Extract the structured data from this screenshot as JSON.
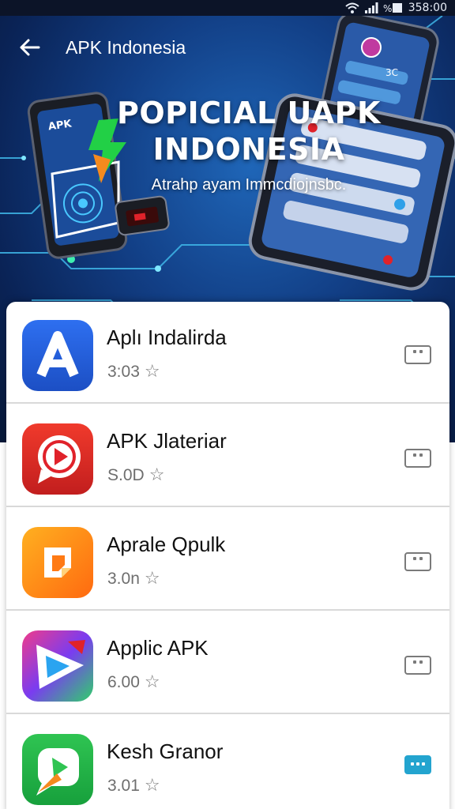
{
  "status_bar": {
    "time": "358:00"
  },
  "app_bar": {
    "title": "APK Indonesia"
  },
  "banner": {
    "title_line1": "POPICIAL UAPK",
    "title_line2": "INDONESIA",
    "subtitle": "Atrahp ayam Immcdiojnsbc.",
    "phone_label": "APK",
    "phone_value": "3C"
  },
  "apps": [
    {
      "name": "Aplı Indalirda",
      "rating": "3:03",
      "icon": "letter-a-icon",
      "colors": [
        "#2e6ff0",
        "#1c4fc4"
      ],
      "action": "more"
    },
    {
      "name": "APK Jlateriar",
      "rating": "S.0D",
      "icon": "play-chat-icon",
      "colors": [
        "#f03a2c",
        "#c21e1e"
      ],
      "action": "more"
    },
    {
      "name": "Aprale Qpulk",
      "rating": "3.0n",
      "icon": "square-chat-icon",
      "colors": [
        "#ffb020",
        "#ff6a10"
      ],
      "action": "more"
    },
    {
      "name": "Applic APK",
      "rating": "6.00",
      "icon": "triangle-play-icon",
      "colors": [
        "#f03c8a",
        "#7a3cf0",
        "#2fd06a"
      ],
      "action": "more"
    },
    {
      "name": "Kesh Granor",
      "rating": "3.01",
      "icon": "green-chat-icon",
      "colors": [
        "#2fc452",
        "#17a03c"
      ],
      "action": "more-active"
    }
  ],
  "accent": "#23a4cf"
}
